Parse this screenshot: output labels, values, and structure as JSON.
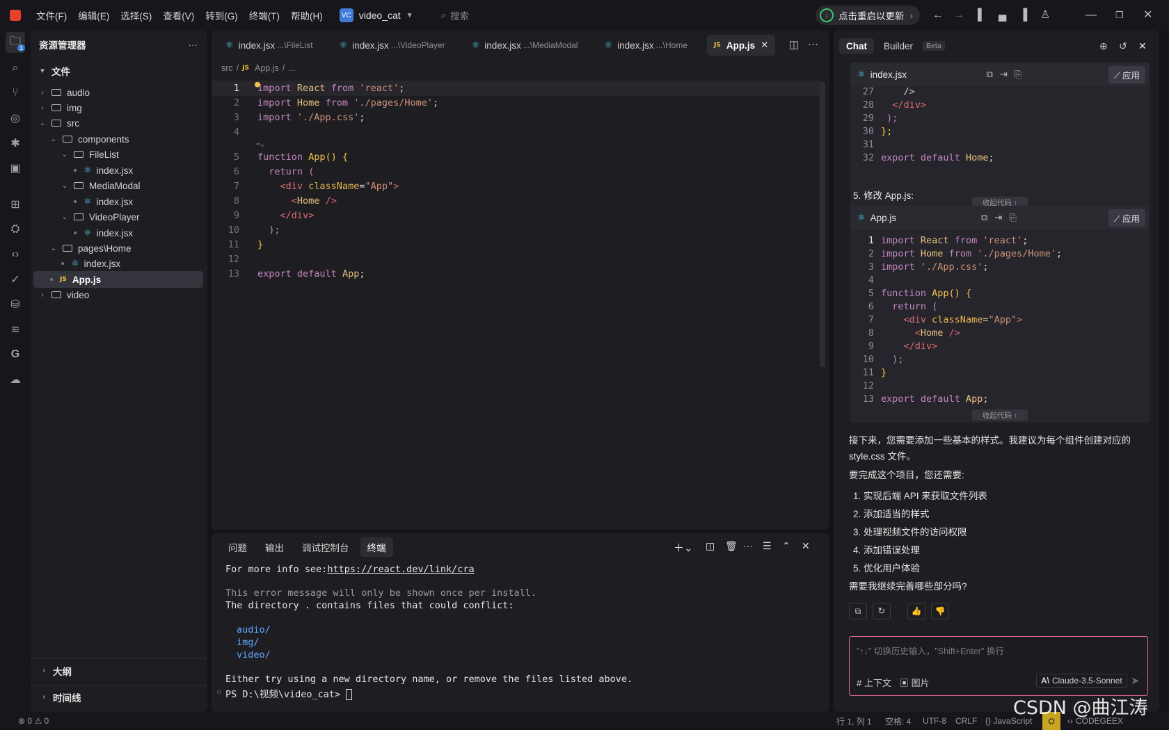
{
  "titlebar": {
    "menus": [
      "文件(F)",
      "编辑(E)",
      "选择(S)",
      "查看(V)",
      "转到(G)",
      "终端(T)",
      "帮助(H)"
    ],
    "project_badge": "VC",
    "project_name": "video_cat",
    "search_placeholder": "搜索",
    "update_label": "点击重启以更新"
  },
  "activity_bar": {
    "explorer_badge": "1"
  },
  "explorer": {
    "title": "资源管理器",
    "more": "···",
    "root": "文件",
    "items": [
      {
        "label": "audio"
      },
      {
        "label": "img"
      },
      {
        "label": "src"
      },
      {
        "label": "components"
      },
      {
        "label": "FileList"
      },
      {
        "label": "index.jsx"
      },
      {
        "label": "MediaModal"
      },
      {
        "label": "index.jsx"
      },
      {
        "label": "VideoPlayer"
      },
      {
        "label": "index.jsx"
      },
      {
        "label": "pages\\Home"
      },
      {
        "label": "index.jsx"
      },
      {
        "label": "App.js"
      },
      {
        "label": "video"
      }
    ],
    "outline_label": "大纲",
    "timeline_label": "时间线"
  },
  "editor": {
    "tabs": [
      {
        "name": "index.jsx",
        "path": "...\\FileList"
      },
      {
        "name": "index.jsx",
        "path": "...\\VideoPlayer"
      },
      {
        "name": "index.jsx",
        "path": "...\\MediaModal"
      },
      {
        "name": "index.jsx",
        "path": "...\\Home"
      },
      {
        "name": "App.js",
        "path": ""
      }
    ],
    "breadcrumb": {
      "src": "src",
      "sep": "/",
      "file": "App.js",
      "more": "..."
    },
    "js_badge": "JS",
    "line_numbers": [
      "1",
      "2",
      "3",
      "4",
      "5",
      "6",
      "7",
      "8",
      "9",
      "10",
      "11",
      "12",
      "13"
    ],
    "fold_hint": "⇔⌄"
  },
  "terminal": {
    "tabs": [
      "问题",
      "输出",
      "调试控制台",
      "终端"
    ],
    "lines": [
      "For more info see:",
      "https://react.dev/link/cra",
      "This error message will only be shown once per install.",
      "The directory . contains files that could conflict:",
      "audio/",
      "img/",
      "video/",
      "Either try using a new directory name, or remove the files listed above.",
      "PS D:\\视频\\video_cat>"
    ]
  },
  "chat": {
    "tabs": [
      "Chat",
      "Builder"
    ],
    "beta": "Beta",
    "block1": {
      "file": "index.jsx",
      "apply": "应用",
      "collapse": "收起代码 ↑",
      "line_numbers": [
        "27",
        "28",
        "29",
        "30",
        "31",
        "32"
      ]
    },
    "step5": "5. 修改 App.js:",
    "block2": {
      "file": "App.js",
      "apply": "应用",
      "collapse": "收起代码 ↑",
      "line_numbers": [
        "1",
        "2",
        "3",
        "4",
        "5",
        "6",
        "7",
        "8",
        "9",
        "10",
        "11",
        "12",
        "13"
      ]
    },
    "para1a": "接下来，您需要添加一些基本的样式。我建议为每个组件创建对应的",
    "para1b": "style.css 文件。",
    "para2": "要完成这个项目，您还需要:",
    "list": [
      "1. 实现后端 API 来获取文件列表",
      "2. 添加适当的样式",
      "3. 处理视频文件的访问权限",
      "4. 添加错误处理",
      "5. 优化用户体验"
    ],
    "question": "需要我继续完善哪些部分吗?",
    "input_placeholder": "\"↑↓\" 切换历史输入，\"Shift+Enter\" 换行",
    "context_btn": "# 上下文",
    "image_btn": "图片",
    "model": "Claude-3.5-Sonnet"
  },
  "status": {
    "problems": "⊗ 0 ⚠ 0",
    "position": "行 1, 列 1",
    "spaces": "空格: 4",
    "encoding": "UTF-8",
    "eol": "CRLF",
    "language": "{} JavaScript",
    "codegeex": "CODEGEEX"
  },
  "watermark": "CSDN @曲江涛",
  "colors": {
    "accent": "#e8412c",
    "update_green": "#3ec46d",
    "input_border": "#e06c8a"
  }
}
